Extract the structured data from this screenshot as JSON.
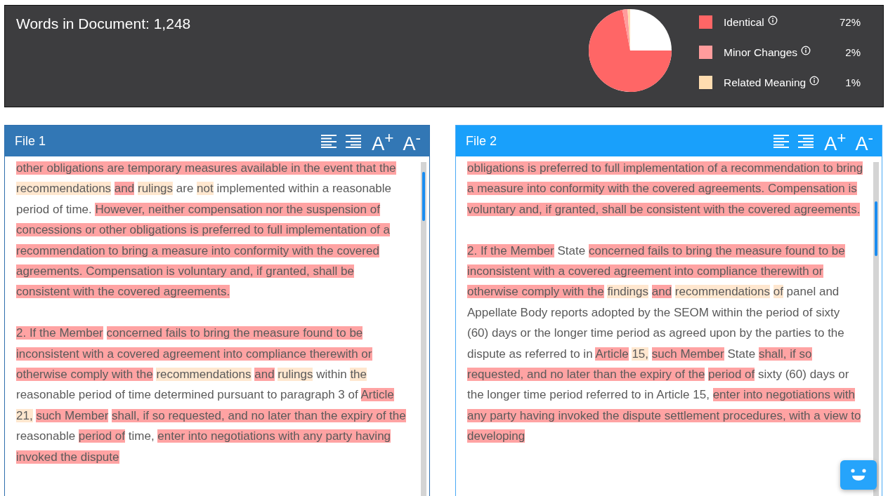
{
  "summary": {
    "words_label": "Words in Document: 1,248",
    "legend": [
      {
        "label": "Identical",
        "percent": "72%",
        "color": "#ff6666"
      },
      {
        "label": "Minor Changes",
        "percent": "2%",
        "color": "#ff9c9c"
      },
      {
        "label": "Related Meaning",
        "percent": "1%",
        "color": "#ffdcb0"
      }
    ]
  },
  "panels": [
    {
      "title": "File 1",
      "selected": false,
      "tools": [
        "A$^{+}$",
        "A$^{-}$"
      ],
      "paragraphs": [
        [
          {
            "text": "other obligations are temporary measures available in the event that the",
            "kind": "identical"
          },
          {
            "text": "recommendations",
            "kind": "related"
          },
          {
            "text": "and",
            "kind": "identical"
          },
          {
            "text": "rulings",
            "kind": "related"
          },
          {
            "text": "are",
            "kind": "plain"
          },
          {
            "text": "not",
            "kind": "related"
          },
          {
            "text": "implemented within a reasonable period of time.",
            "kind": "plain"
          },
          {
            "text": "However, neither compensation nor the suspension of concessions or other obligations is preferred to full implementation of a recommendation to bring a measure into conformity with the covered agreements. Compensation is voluntary and, if granted, shall be consistent with the covered agreements.",
            "kind": "identical"
          }
        ],
        [
          {
            "text": "2. If the Member",
            "kind": "identical"
          },
          {
            "text": "concerned fails to bring the measure found to be inconsistent with a covered agreement into compliance therewith or otherwise comply with the",
            "kind": "identical"
          },
          {
            "text": "recommendations",
            "kind": "related"
          },
          {
            "text": "and",
            "kind": "identical"
          },
          {
            "text": "rulings",
            "kind": "related"
          },
          {
            "text": "within",
            "kind": "plain"
          },
          {
            "text": "the",
            "kind": "related"
          },
          {
            "text": "reasonable period of time determined pursuant to paragraph 3 of",
            "kind": "plain"
          },
          {
            "text": "Article",
            "kind": "identical"
          },
          {
            "text": "21,",
            "kind": "related"
          },
          {
            "text": "such Member",
            "kind": "identical"
          },
          {
            "text": "shall, if so requested, and no later than the expiry of the",
            "kind": "identical"
          },
          {
            "text": "reasonable",
            "kind": "plain"
          },
          {
            "text": "period of",
            "kind": "identical"
          },
          {
            "text": "time,",
            "kind": "plain"
          },
          {
            "text": "enter into negotiations with any party having invoked the dispute",
            "kind": "identical"
          }
        ]
      ]
    },
    {
      "title": "File 2",
      "selected": true,
      "tools": [
        "A$^{+}$",
        "A$^{-}$"
      ],
      "paragraphs": [
        [
          {
            "text": "obligations is preferred to full implementation of a recommendation to bring a measure into conformity with the covered agreements. Compensation is voluntary and, if granted, shall be consistent with the covered agreements.",
            "kind": "identical"
          }
        ],
        [
          {
            "text": "2. If the Member",
            "kind": "identical"
          },
          {
            "text": "State",
            "kind": "plain"
          },
          {
            "text": "concerned fails to bring the measure found to be inconsistent with a covered agreement into compliance therewith or otherwise comply with the",
            "kind": "identical"
          },
          {
            "text": "findings",
            "kind": "related"
          },
          {
            "text": "and",
            "kind": "identical"
          },
          {
            "text": "recommendations",
            "kind": "related"
          },
          {
            "text": "of",
            "kind": "related"
          },
          {
            "text": "panel and Appellate Body reports adopted by the SEOM within the period of sixty (60) days or the longer time period as agreed upon by the parties to the dispute as referred to in",
            "kind": "plain"
          },
          {
            "text": "Article",
            "kind": "identical"
          },
          {
            "text": "15,",
            "kind": "related"
          },
          {
            "text": "such Member",
            "kind": "identical"
          },
          {
            "text": "State",
            "kind": "plain"
          },
          {
            "text": "shall, if so requested, and no later than the expiry of the",
            "kind": "identical"
          },
          {
            "text": "period of",
            "kind": "identical"
          },
          {
            "text": "sixty (60) days or the longer time period referred to in Article 15,",
            "kind": "plain"
          },
          {
            "text": "enter into negotiations with any party having invoked the dispute settlement procedures, with a view to developing",
            "kind": "identical"
          }
        ]
      ]
    }
  ]
}
